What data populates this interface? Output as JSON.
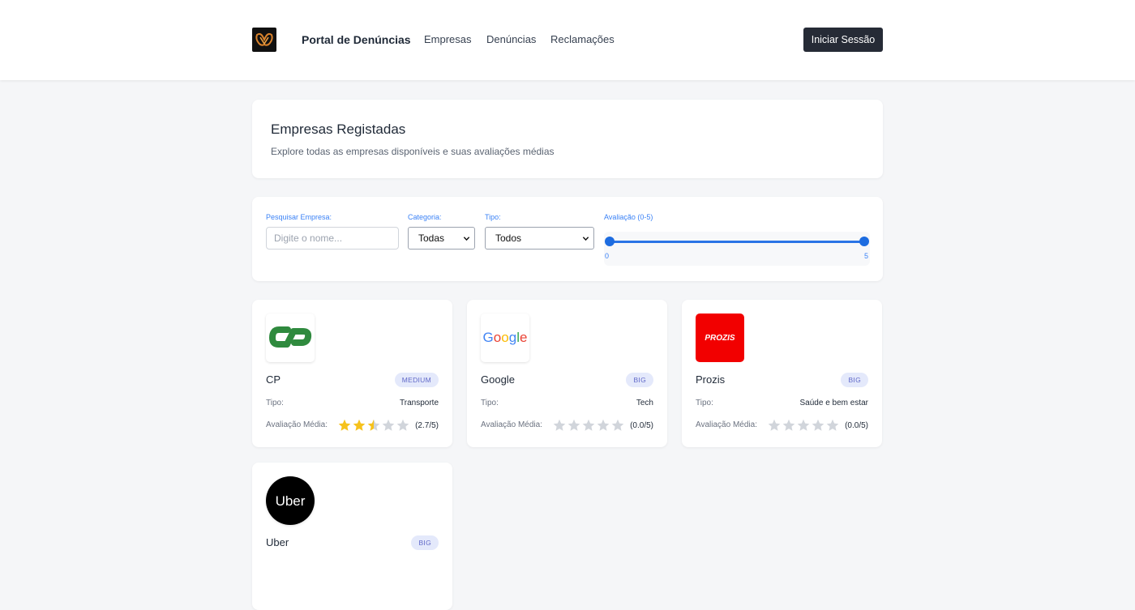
{
  "nav": {
    "brand": "Portal de Denúncias",
    "links": [
      "Empresas",
      "Denúncias",
      "Reclamações"
    ],
    "login": "Iniciar Sessão"
  },
  "header": {
    "title": "Empresas Registadas",
    "subtitle": "Explore todas as empresas disponíveis e suas avaliações médias"
  },
  "filters": {
    "search_label": "Pesquisar Empresa:",
    "search_placeholder": "Digite o nome...",
    "search_value": "",
    "category_label": "Categoria:",
    "category_value": "Todas",
    "type_label": "Tipo:",
    "type_value": "Todos",
    "rating_label": "Avaliação (0-5)",
    "rating_min": "0",
    "rating_max": "5"
  },
  "companies": [
    {
      "name": "CP",
      "badge": "MEDIUM",
      "type_label": "Tipo:",
      "type": "Transporte",
      "rating_label": "Avaliação Média:",
      "rating": 2.7,
      "score": "(2.7/5)",
      "logo_icon": "cp-logo-icon"
    },
    {
      "name": "Google",
      "badge": "BIG",
      "type_label": "Tipo:",
      "type": "Tech",
      "rating_label": "Avaliação Média:",
      "rating": 0.0,
      "score": "(0.0/5)",
      "logo_icon": "google-logo-icon",
      "logo_text": "Google"
    },
    {
      "name": "Prozis",
      "badge": "BIG",
      "type_label": "Tipo:",
      "type": "Saúde e bem estar",
      "rating_label": "Avaliação Média:",
      "rating": 0.0,
      "score": "(0.0/5)",
      "logo_icon": "prozis-logo-icon",
      "logo_text": "PROZIS"
    },
    {
      "name": "Uber",
      "badge": "BIG",
      "logo_icon": "uber-logo-icon",
      "logo_text": "Uber"
    }
  ],
  "colors": {
    "star_filled": "#f6c21c",
    "star_empty": "#d1d5db",
    "accent": "#1d6ce0",
    "login_bg": "#262b36",
    "badge_bg": "#e4e9fb",
    "badge_fg": "#6068c8",
    "prozis_red": "#f20000",
    "cp_green": "#2f8a3e"
  }
}
